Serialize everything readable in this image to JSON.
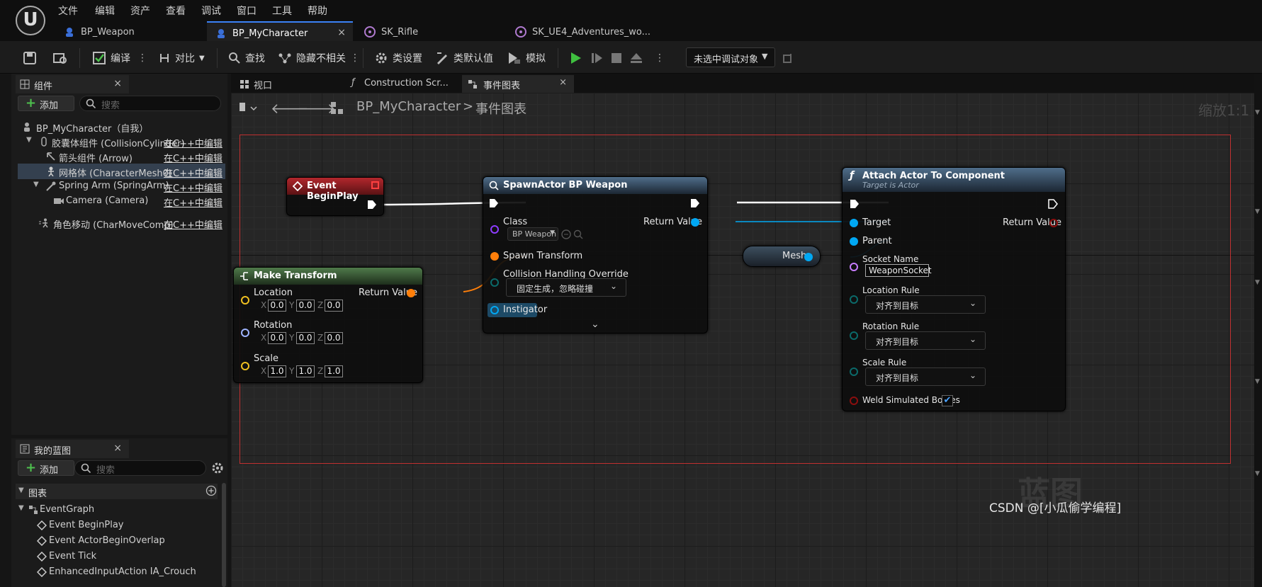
{
  "menu": [
    "文件",
    "编辑",
    "资产",
    "查看",
    "调试",
    "窗口",
    "工具",
    "帮助"
  ],
  "tabs": [
    {
      "label": "BP_Weapon"
    },
    {
      "label": "BP_MyCharacter",
      "close": "×"
    },
    {
      "label": "SK_Rifle"
    },
    {
      "label": "SK_UE4_Adventures_wo..."
    }
  ],
  "toolbar": {
    "compile": "编译",
    "diff": "对比",
    "find": "查找",
    "hide_unrelated": "隐藏不相关",
    "class_settings": "类设置",
    "class_defaults": "类默认值",
    "simulate": "模拟",
    "debug_target": "未选中调试对象"
  },
  "components_panel": {
    "title": "组件",
    "close": "×",
    "add": "添加",
    "search_placeholder": "搜索",
    "items": [
      {
        "label": "BP_MyCharacter（自我）",
        "edit": ""
      },
      {
        "label": "胶囊体组件 (CollisionCylinder)",
        "edit": "在C++中编辑"
      },
      {
        "label": "箭头组件 (Arrow)",
        "edit": "在C++中编辑"
      },
      {
        "label": "网格体 (CharacterMesh0)",
        "edit": "在C++中编辑"
      },
      {
        "label": "Spring Arm (SpringArm)",
        "edit": "在C++中编辑"
      },
      {
        "label": "Camera (Camera)",
        "edit": "在C++中编辑"
      },
      {
        "label": "角色移动 (CharMoveComp)",
        "edit": "在C++中编辑"
      }
    ]
  },
  "my_blueprint": {
    "title": "我的蓝图",
    "close": "×",
    "add": "添加",
    "search_placeholder": "搜索",
    "section": "图表",
    "graph": "EventGraph",
    "events": [
      "Event BeginPlay",
      "Event ActorBeginOverlap",
      "Event Tick",
      "EnhancedInputAction IA_Crouch"
    ]
  },
  "editor_tabs": [
    {
      "label": "视口"
    },
    {
      "label": "Construction Scr..."
    },
    {
      "label": "事件图表",
      "close": "×"
    }
  ],
  "breadcrumb": {
    "root": "BP_MyCharacter",
    "sep": ">",
    "current": "事件图表"
  },
  "zoom": "缩放1:1",
  "nodes": {
    "begin_play": {
      "title": "Event BeginPlay"
    },
    "make_transform": {
      "title": "Make Transform",
      "return": "Return Value",
      "rows": [
        {
          "label": "Location",
          "x": "0.0",
          "y": "0.0",
          "z": "0.0"
        },
        {
          "label": "Rotation",
          "x": "0.0",
          "y": "0.0",
          "z": "0.0"
        },
        {
          "label": "Scale",
          "x": "1.0",
          "y": "1.0",
          "z": "1.0"
        }
      ],
      "axes": [
        "X",
        "Y",
        "Z"
      ]
    },
    "spawn": {
      "title": "SpawnActor BP Weapon",
      "class": "Class",
      "class_value": "BP Weapon",
      "return": "Return Value",
      "spawn_transform": "Spawn Transform",
      "collision": "Collision Handling Override",
      "collision_value": "固定生成，忽略碰撞",
      "instigator": "Instigator"
    },
    "mesh": {
      "label": "Mesh"
    },
    "attach": {
      "title": "Attach Actor To Component",
      "subtitle": "Target is Actor",
      "target": "Target",
      "parent": "Parent",
      "return": "Return Value",
      "socket_name": "Socket Name",
      "socket_value": "WeaponSocket",
      "location_rule": "Location Rule",
      "rotation_rule": "Rotation Rule",
      "scale_rule": "Scale Rule",
      "rule_value": "对齐到目标",
      "weld": "Weld Simulated Bodies",
      "weld_checked": true
    }
  },
  "watermark": "CSDN @[小瓜偷学编程]",
  "faint_mark": "蓝图",
  "colors": {
    "exec": "#ffffff",
    "object": "#00a8f4",
    "struct": "#ff7f0a",
    "vector": "#f0c020",
    "rotator": "#9fb4ff",
    "name": "#c87dff",
    "enum": "#0b6a6a",
    "bool": "#8c0e0e",
    "accent": "#3b82f6"
  }
}
